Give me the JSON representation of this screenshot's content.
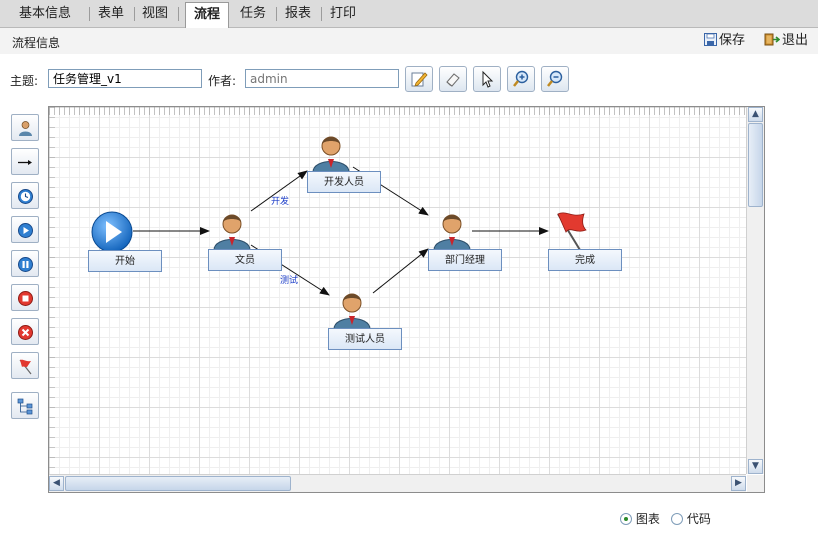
{
  "tabs": [
    {
      "label": "基本信息"
    },
    {
      "label": "表单"
    },
    {
      "label": "视图"
    },
    {
      "label": "流程"
    },
    {
      "label": "任务"
    },
    {
      "label": "报表"
    },
    {
      "label": "打印"
    }
  ],
  "active_tab": "流程",
  "subbar": {
    "title": "流程信息",
    "save_label": "保存",
    "exit_label": "退出"
  },
  "form": {
    "subject_label": "主题:",
    "subject_value": "任务管理_v1",
    "author_label": "作者:",
    "author_placeholder": "admin"
  },
  "toolbar_icons": [
    "edit-icon",
    "eraser-icon",
    "pointer-icon",
    "zoom-in-icon",
    "zoom-out-icon"
  ],
  "palette_icons": [
    "user-node-icon",
    "arrow-line-icon",
    "timer-icon",
    "play-icon",
    "pause-icon",
    "stop-icon",
    "cancel-icon",
    "flag-icon",
    "subflow-icon"
  ],
  "workflow": {
    "nodes": [
      {
        "id": "start",
        "label": "开始",
        "type": "start"
      },
      {
        "id": "writer",
        "label": "文员",
        "type": "user"
      },
      {
        "id": "dev",
        "label": "开发人员",
        "type": "user"
      },
      {
        "id": "tester",
        "label": "测试人员",
        "type": "user"
      },
      {
        "id": "manager",
        "label": "部门经理",
        "type": "user"
      },
      {
        "id": "done",
        "label": "完成",
        "type": "end"
      }
    ],
    "edges": [
      {
        "from": "start",
        "to": "writer",
        "label": ""
      },
      {
        "from": "writer",
        "to": "dev",
        "label": "开发"
      },
      {
        "from": "writer",
        "to": "tester",
        "label": "测试"
      },
      {
        "from": "dev",
        "to": "manager",
        "label": ""
      },
      {
        "from": "tester",
        "to": "manager",
        "label": ""
      },
      {
        "from": "manager",
        "to": "done",
        "label": ""
      }
    ]
  },
  "view_mode": {
    "chart_label": "图表",
    "code_label": "代码",
    "selected": "图表"
  },
  "colors": {
    "tabbar": "#dcdcdc",
    "node_border": "#6c8fbf",
    "edge_label": "#1a3cc8",
    "grid": "#dcdcdc"
  }
}
